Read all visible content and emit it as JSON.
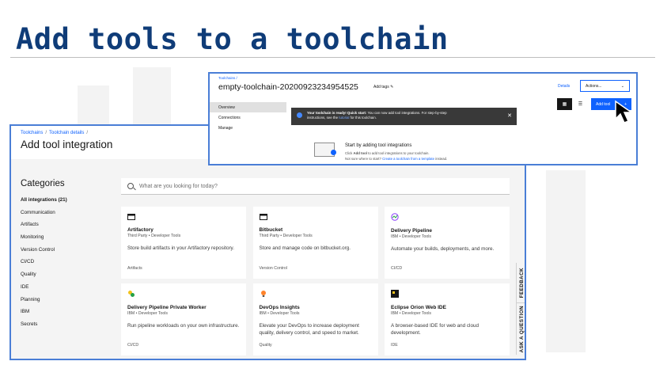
{
  "slide": {
    "title": "Add tools to a toolchain"
  },
  "toolchain": {
    "breadcrumb": "Toolchains  /",
    "name": "empty-toolchain-20200923234954525",
    "add_tags": "Add tags",
    "details": "Details",
    "actions": "Actions...",
    "nav": [
      "Overview",
      "Connections",
      "Manage"
    ],
    "toast": {
      "bold": "Your toolchain is ready! Quick start:",
      "text1": " You can now add tool integrations. For step-by-step",
      "text2": "instructions, see the ",
      "link": "tutorial",
      "text3": " for this toolchain."
    },
    "add_tool": "Add tool",
    "start_title": "Start by adding tool integrations",
    "start_line1_pre": "Click ",
    "start_line1_bold": "Add tool",
    "start_line1_post": " to add tool integrations to your toolchain.",
    "start_line2_pre": "Not sure where to start? ",
    "start_line2_link": "Create a toolchain from a template",
    "start_line2_post": " instead."
  },
  "integration": {
    "crumbs": [
      "Toolchains",
      "Toolchain details"
    ],
    "title": "Add tool integration",
    "categories_title": "Categories",
    "categories": [
      "All integrations (21)",
      "Communication",
      "Artifacts",
      "Monitoring",
      "Version Control",
      "CI/CD",
      "Quality",
      "IDE",
      "Planning",
      "IBM",
      "Secrets"
    ],
    "search_placeholder": "What are you looking for today?",
    "cards": [
      {
        "name": "Artifactory",
        "sub": "Third Party • Developer Tools",
        "desc": "Store build artifacts in your Artifactory repository.",
        "tag": "Artifacts",
        "icon": "box-icon"
      },
      {
        "name": "Bitbucket",
        "sub": "Third Party • Developer Tools",
        "desc": "Store and manage code on bitbucket.org.",
        "tag": "Version Control",
        "icon": "box-icon"
      },
      {
        "name": "Delivery Pipeline",
        "sub": "IBM • Developer Tools",
        "desc": "Automate your builds, deployments, and more.",
        "tag": "CI/CD",
        "icon": "pipeline-icon"
      },
      {
        "name": "Delivery Pipeline Private Worker",
        "sub": "IBM • Developer Tools",
        "desc": "Run pipeline workloads on your own infrastructure.",
        "tag": "CI/CD",
        "icon": "worker-icon"
      },
      {
        "name": "DevOps Insights",
        "sub": "IBM • Developer Tools",
        "desc": "Elevate your DevOps to increase deployment quality, delivery control, and speed to market.",
        "tag": "Quality",
        "icon": "bulb-icon"
      },
      {
        "name": "Eclipse Orion Web IDE",
        "sub": "IBM • Developer Tools",
        "desc": "A browser-based IDE for web and cloud development.",
        "tag": "IDE",
        "icon": "ide-icon"
      }
    ],
    "side_tabs": [
      "FEEDBACK",
      "ASK A QUESTION"
    ]
  }
}
